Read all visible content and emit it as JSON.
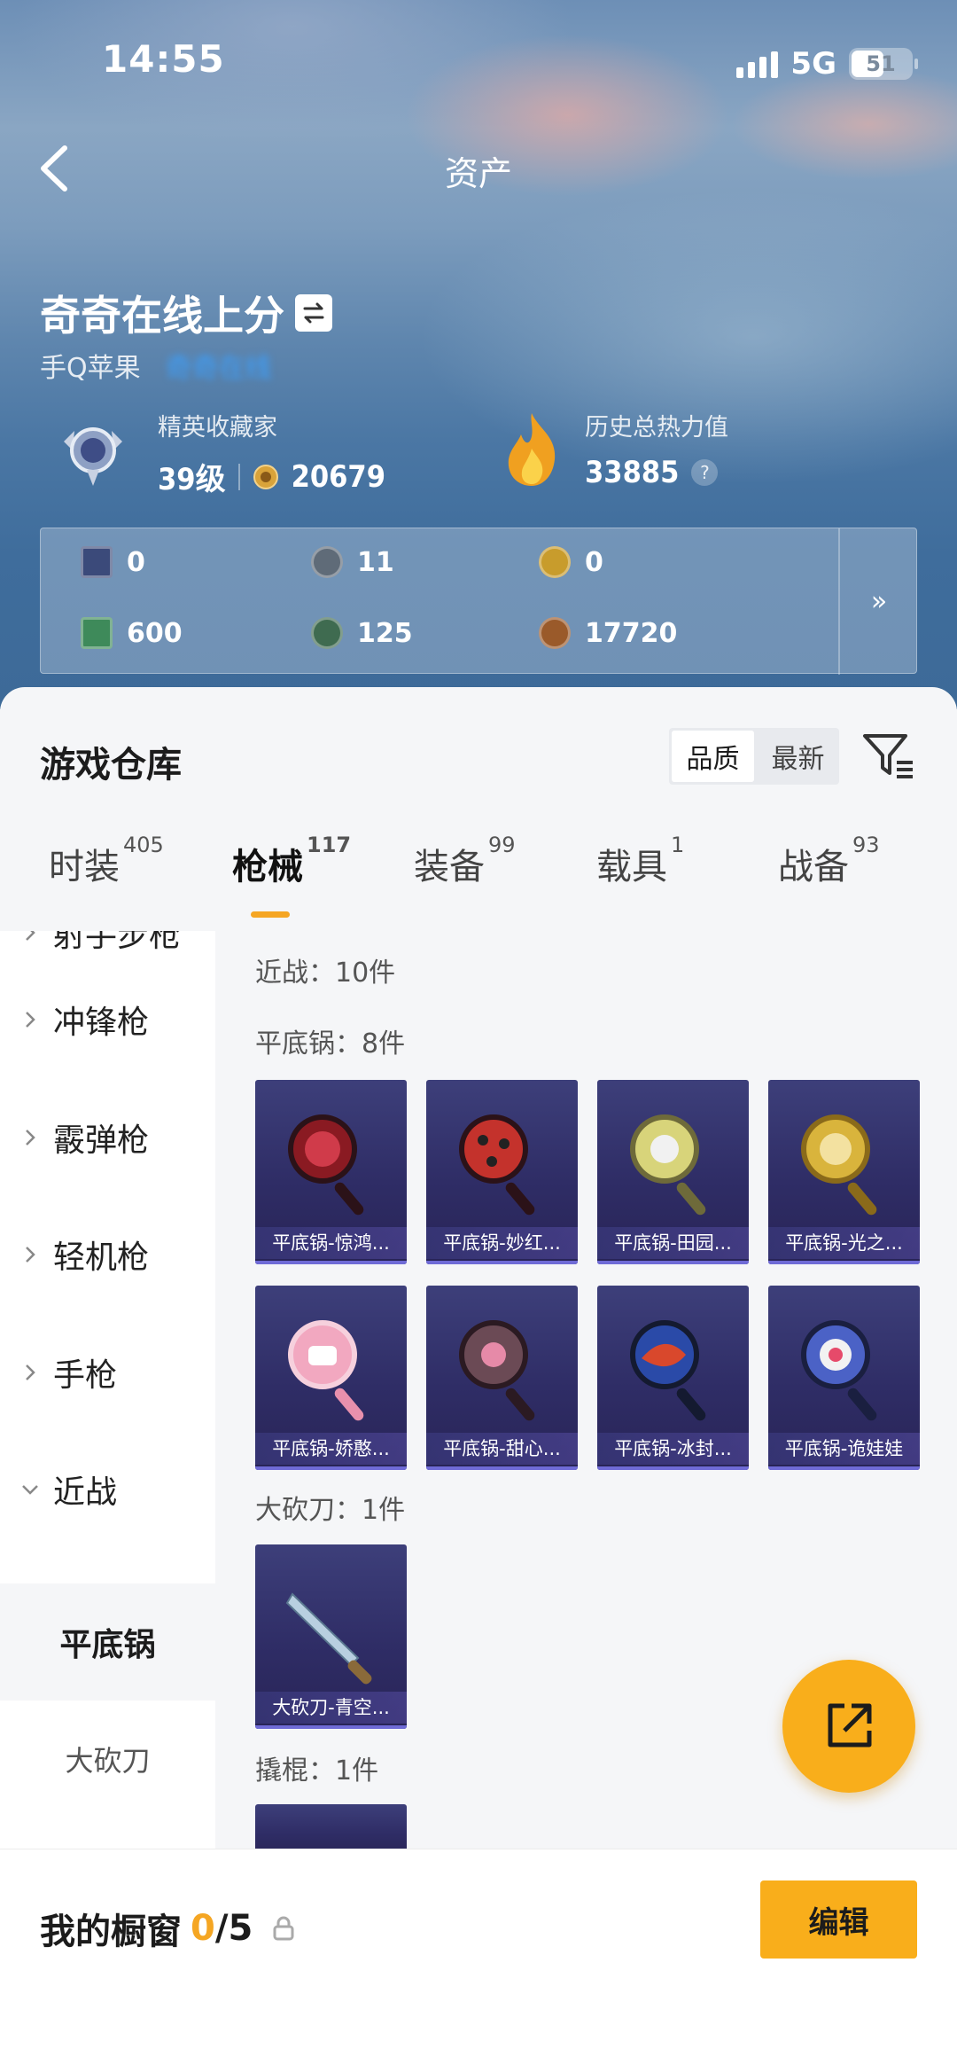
{
  "status_bar": {
    "time": "14:55",
    "network": "5G",
    "battery": "51"
  },
  "nav": {
    "title": "资产"
  },
  "profile": {
    "name": "奇奇在线上分",
    "platform": "手Q苹果",
    "account_tag": "奇奇在线"
  },
  "stats": {
    "collector_label": "精英收藏家",
    "level": "39级",
    "points": "20679",
    "heat_label": "历史总热力值",
    "heat_value": "33885",
    "help": "?"
  },
  "currencies": {
    "row1": [
      {
        "icon": "card-icon",
        "value": "0",
        "color": "#3b4a7a"
      },
      {
        "icon": "coin-silver-icon",
        "value": "11",
        "color": "#5f6b78"
      },
      {
        "icon": "coin-gold-icon",
        "value": "0",
        "color": "#c89c2c"
      }
    ],
    "row2": [
      {
        "icon": "ticket-green-icon",
        "value": "600",
        "color": "#3e8a5a"
      },
      {
        "icon": "gem-green-icon",
        "value": "125",
        "color": "#3f6b50"
      },
      {
        "icon": "coin-bronze-icon",
        "value": "17720",
        "color": "#9a5a2a"
      }
    ],
    "more": "»"
  },
  "warehouse": {
    "title": "游戏仓库",
    "sort": [
      "品质",
      "最新"
    ],
    "active_sort": "品质"
  },
  "tabs": [
    {
      "label": "时装",
      "count": "405"
    },
    {
      "label": "枪械",
      "count": "117"
    },
    {
      "label": "装备",
      "count": "99"
    },
    {
      "label": "载具",
      "count": "1"
    },
    {
      "label": "战备",
      "count": "93"
    }
  ],
  "side_nav": {
    "items": [
      "射手步枪",
      "冲锋枪",
      "霰弹枪",
      "轻机枪",
      "手枪",
      "近战"
    ],
    "selected": "平底锅",
    "sub": "大砍刀"
  },
  "groups": {
    "melee": "近战：10件",
    "pan": "平底锅：8件",
    "machete": "大砍刀：1件",
    "crowbar": "撬棍：1件"
  },
  "pan_items": [
    {
      "name": "平底锅-惊鸿...",
      "color": "#8a1a22",
      "accent": "#d03b4a"
    },
    {
      "name": "平底锅-妙红...",
      "color": "#c4322c",
      "accent": "#222"
    },
    {
      "name": "平底锅-田园...",
      "color": "#d8d47a",
      "accent": "#f1f1f1"
    },
    {
      "name": "平底锅-光之...",
      "color": "#d9b43c",
      "accent": "#f3e1a0"
    },
    {
      "name": "平底锅-娇憨...",
      "color": "#f2a8c0",
      "accent": "#ffffff"
    },
    {
      "name": "平底锅-甜心...",
      "color": "#6b4a55",
      "accent": "#e68aa8"
    },
    {
      "name": "平底锅-冰封...",
      "color": "#2a4aa8",
      "accent": "#d9482c"
    },
    {
      "name": "平底锅-诡娃娃",
      "color": "#4b62c6",
      "accent": "#e64a6a"
    }
  ],
  "machete_items": [
    {
      "name": "大砍刀-青空..."
    }
  ],
  "showcase": {
    "label": "我的橱窗",
    "count": "0",
    "total": "/5",
    "edit": "编辑"
  }
}
